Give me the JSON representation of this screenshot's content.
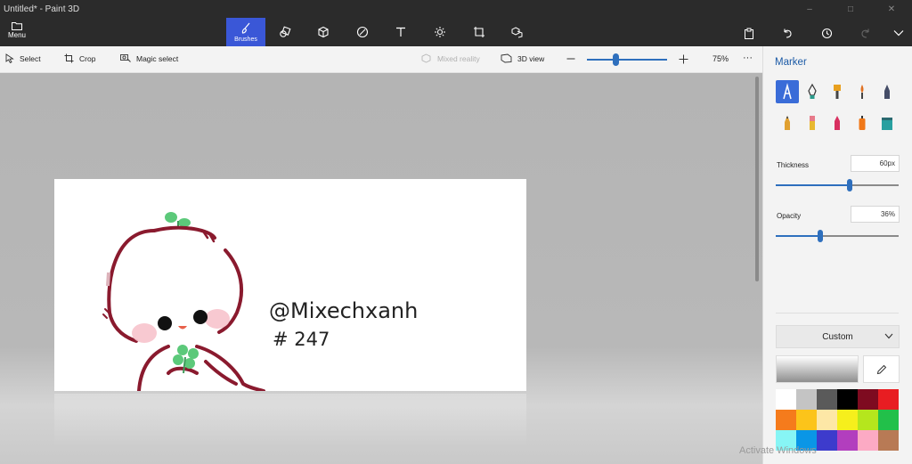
{
  "app": {
    "title": "Untitled* - Paint 3D"
  },
  "window_controls": {
    "minimize": "–",
    "maximize": "□",
    "close": "✕"
  },
  "menu": {
    "label": "Menu"
  },
  "tabs": [
    {
      "id": "brushes",
      "label": "Brushes",
      "icon": "brush-icon",
      "active": true
    },
    {
      "id": "2d-shapes",
      "label": "",
      "icon": "2d-shapes-icon"
    },
    {
      "id": "3d-shapes",
      "label": "",
      "icon": "cube-icon"
    },
    {
      "id": "stickers",
      "label": "",
      "icon": "stickers-icon"
    },
    {
      "id": "text",
      "label": "",
      "icon": "text-icon"
    },
    {
      "id": "effects",
      "label": "",
      "icon": "effects-sun-icon"
    },
    {
      "id": "canvas",
      "label": "",
      "icon": "canvas-crop-icon"
    },
    {
      "id": "3d-library",
      "label": "",
      "icon": "3d-library-icon"
    }
  ],
  "right_tools": [
    "paste-icon",
    "undo-icon",
    "history-icon",
    "redo-icon",
    "chevron-down-icon"
  ],
  "subtoolbar": {
    "select": "Select",
    "crop": "Crop",
    "magic_select": "Magic select",
    "mixed_reality": "Mixed reality",
    "view_3d": "3D view",
    "zoom_value": "75%",
    "more": "···"
  },
  "panel": {
    "title": "Marker",
    "brushes": [
      {
        "name": "marker",
        "color": "#2a3d8f",
        "active": true
      },
      {
        "name": "calligraphy-pen",
        "color": "#2a9a8a"
      },
      {
        "name": "oil-brush",
        "color": "#e8a020"
      },
      {
        "name": "watercolor",
        "color": "#e07020"
      },
      {
        "name": "pixel-pen",
        "color": "#444c66"
      },
      {
        "name": "pencil",
        "color": "#e0a030"
      },
      {
        "name": "eraser",
        "color": "#e77a8a"
      },
      {
        "name": "crayon",
        "color": "#d83060"
      },
      {
        "name": "spray-can",
        "color": "#f07818"
      },
      {
        "name": "fill",
        "color": "#28a0a0"
      }
    ],
    "thickness": {
      "label": "Thickness",
      "value": "60px",
      "level": 0.6
    },
    "opacity": {
      "label": "Opacity",
      "value": "36%",
      "level": 0.36
    },
    "color_dropdown": "Custom",
    "palette": [
      "#ffffff",
      "#c4c4c4",
      "#5a5a5a",
      "#000000",
      "#7e0b20",
      "#e81d22",
      "#f57b1c",
      "#fcc41a",
      "#fde7a6",
      "#f6ef1c",
      "#b5e61d",
      "#22c04a",
      "#87f5f5",
      "#0a96e6",
      "#3d3bcc",
      "#b23ebe",
      "#fcaac4",
      "#b87a55"
    ]
  },
  "canvas": {
    "signature_line1": "@Mixechxanh",
    "signature_line2": "# 247"
  },
  "watermark": "Activate Windows"
}
